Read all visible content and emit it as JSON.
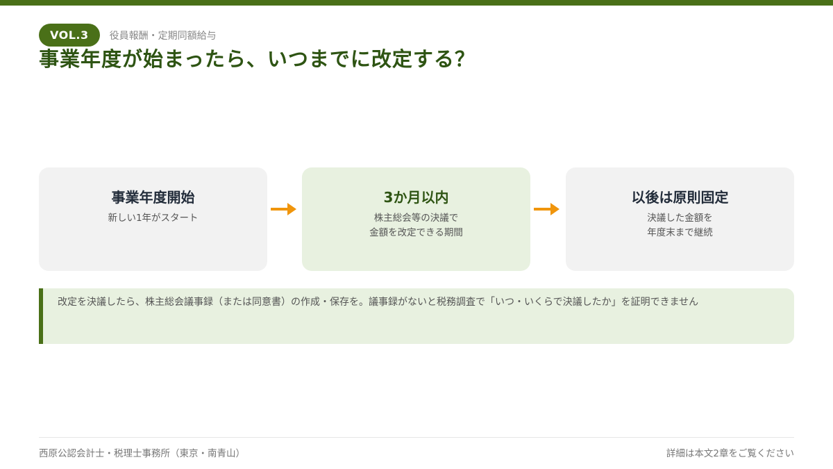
{
  "header": {
    "badge": "VOL.3",
    "series": "役員報酬・定期同額給与",
    "title": "事業年度が始まったら、いつまでに改定する？"
  },
  "steps": [
    {
      "title": "事業年度開始",
      "desc_lines": [
        "新しい1年がスタート"
      ]
    },
    {
      "title": "3か月以内",
      "desc_lines": [
        "株主総会等の決議で",
        "金額を改定できる期間"
      ]
    },
    {
      "title": "以後は原則固定",
      "desc_lines": [
        "決議した金額を",
        "年度末まで継続"
      ]
    }
  ],
  "note": {
    "text": "改定を決議したら、株主総会議事録（または同意書）の作成・保存を。議事録がないと税務調査で「いつ・いくらで決議したか」を証明できません"
  },
  "footer": {
    "left": "西原公認会計士・税理士事務所（東京・南青山）",
    "right": "詳細は本文2章をご覧ください"
  },
  "colors": {
    "accent": "#4a7018",
    "title": "#2e5413",
    "arrow": "#f0950c",
    "active_card": "#e8f1e0",
    "card": "#f2f2f2"
  }
}
